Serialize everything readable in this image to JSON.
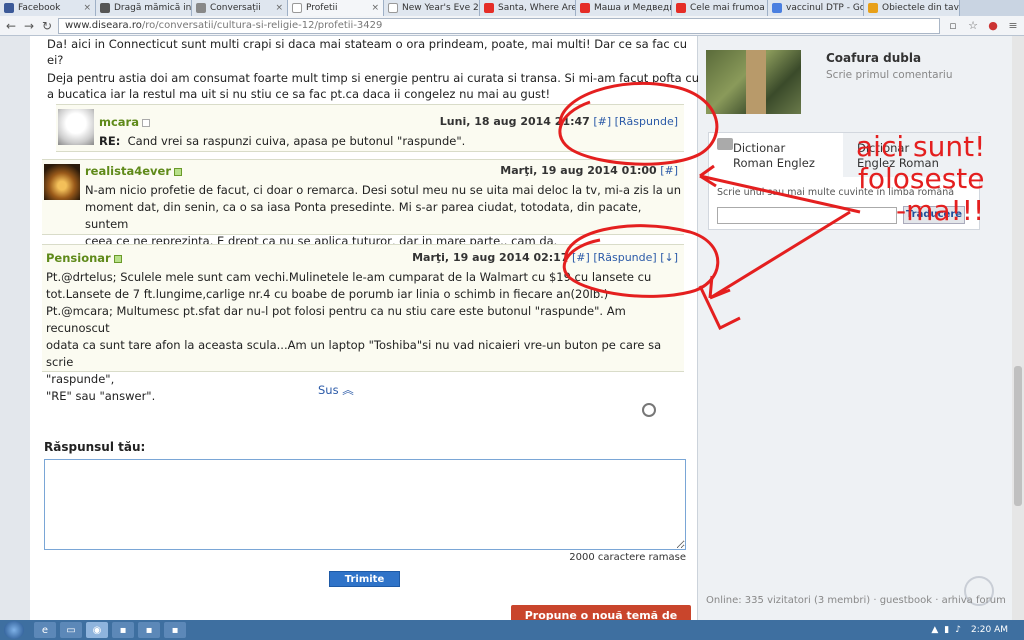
{
  "browser": {
    "tabs": [
      {
        "label": "Facebook",
        "favicon": "facebook-icon"
      },
      {
        "label": "Dragă mămică inta",
        "favicon": "page-icon"
      },
      {
        "label": "Conversații",
        "favicon": "page-icon"
      },
      {
        "label": "Profetii",
        "favicon": "document-icon",
        "active": true
      },
      {
        "label": "New Year's Eve 20",
        "favicon": "document-icon"
      },
      {
        "label": "Santa, Where Are",
        "favicon": "youtube-icon"
      },
      {
        "label": "Маша и Медведь",
        "favicon": "youtube-icon"
      },
      {
        "label": "Cele mai frumoa",
        "favicon": "youtube-icon"
      },
      {
        "label": "vaccinul DTP - Go",
        "favicon": "google-icon"
      },
      {
        "label": "Obiectele din tava",
        "favicon": "page-icon"
      }
    ],
    "url_host": "www.diseara.ro",
    "url_path": "/ro/conversatii/cultura-si-religie-12/profetii-3429"
  },
  "post_intro": [
    "Da! aici in Connecticut sunt multi crapi si daca mai stateam o ora prindeam, poate, mai multi! Dar ce sa fac cu",
    "ei?",
    "Deja pentru astia doi am consumat foarte mult timp si energie pentru ai curata si transa. Si mi-am facut pofta cu",
    "a bucatica iar la restul ma uit si nu stiu ce sa fac pt.ca daca ii congelez nu mai au gust!"
  ],
  "comments": [
    {
      "user": "mcara",
      "date": "Luni, 18 aug 2014 21:47",
      "anchor": "[#]",
      "reply": "[Răspunde]",
      "body_label": "RE:",
      "body": "Cand vrei sa raspunzi cuiva, apasa pe butonul \"raspunde\"."
    },
    {
      "user": "realista4ever",
      "date": "Marţi, 19 aug 2014 01:00",
      "anchor": "[#]",
      "body": [
        "N-am nicio profetie de facut, ci doar o remarca. Desi sotul meu nu se uita mai deloc la tv, mi-a zis la un",
        "moment dat, din senin, ca o sa iasa Ponta presedinte. Mi s-ar parea ciudat, totodata, din pacate, suntem",
        "ceea ce ne reprezinta. E drept ca nu se aplica tuturor, dar in mare parte.. cam da."
      ]
    },
    {
      "user": "Pensionar",
      "date": "Marţi, 19 aug 2014 02:17",
      "anchor": "[#]",
      "reply": "[Răspunde]",
      "down": "[↓]",
      "body": [
        "Pt.@drtelus; Sculele mele sunt cam vechi.Mulinetele le-am cumparat de la Walmart cu $19 cu lansete cu",
        "tot.Lansete de 7 ft.lungime,carlige nr.4 cu boabe de porumb iar linia o schimb in fiecare an(20lb.)",
        "Pt.@mcara; Multumesc pt.sfat dar nu-l pot folosi pentru ca nu stiu care este butonul \"raspunde\". Am recunoscut",
        "odata ca sunt tare afon la aceasta scula...Am un laptop \"Toshiba\"si nu vad nicaieri vre-un buton pe care sa scrie",
        "\"raspunde\",",
        "\"RE\" sau \"answer\"."
      ]
    }
  ],
  "back_to_top": "Sus",
  "reply_form": {
    "label": "Răspunsul tău:",
    "value": "",
    "char_count": "2000 caractere ramase",
    "submit": "Trimite"
  },
  "new_topic_button": "Propune o nouă temă de discuție",
  "sidebar": {
    "article_title": "Coafura dubla",
    "article_sub": "Scrie primul comentariu",
    "dictionary": {
      "tab1": [
        "Dictionar",
        "Roman Englez"
      ],
      "tab2": [
        "Dictionar",
        "Englez Roman"
      ],
      "hint": "Scrie unul sau mai multe cuvinte în limba română",
      "input_value": "",
      "button": "Traducere"
    },
    "footer": "Online: 335 vizitatori (3 membri) · guestbook · arhiva forum"
  },
  "annotation": {
    "lines": [
      "aici sunt!",
      "foloseste",
      "-ma!!!"
    ],
    "color": "#e41f1f"
  },
  "taskbar": {
    "clock": "2:20 AM"
  }
}
